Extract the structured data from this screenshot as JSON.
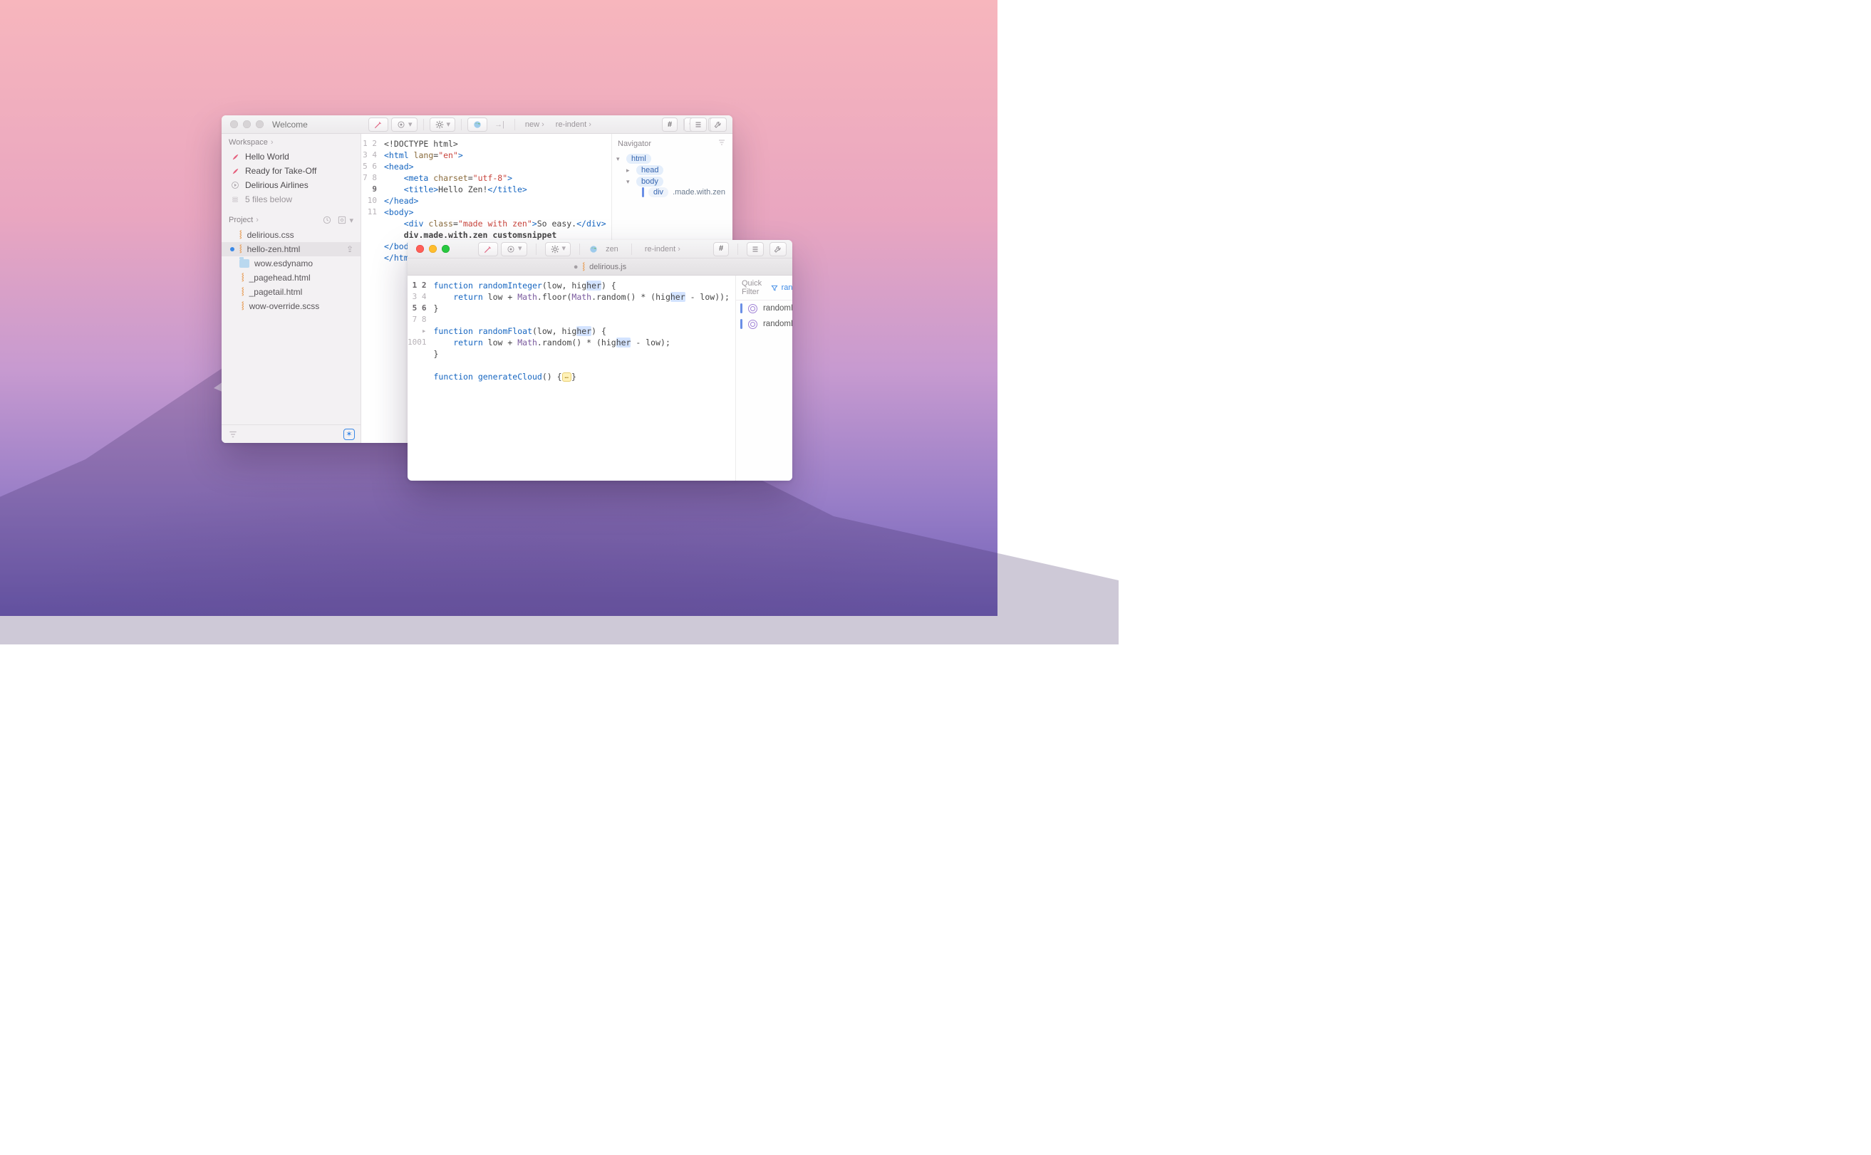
{
  "back": {
    "title": "Welcome",
    "workspace_header": "Workspace",
    "workspace_items": [
      {
        "label": "Hello World",
        "icon": "rocket"
      },
      {
        "label": "Ready for Take-Off",
        "icon": "rocket"
      },
      {
        "label": "Delirious Airlines",
        "icon": "play"
      }
    ],
    "below_label": "5 files below",
    "project_header": "Project",
    "files": [
      {
        "name": "delirious.css",
        "kind": "file",
        "selected": false
      },
      {
        "name": "hello-zen.html",
        "kind": "file",
        "selected": true
      },
      {
        "name": "wow.esdynamo",
        "kind": "folder",
        "selected": false
      },
      {
        "name": "_pagehead.html",
        "kind": "file",
        "selected": false,
        "indent": true
      },
      {
        "name": "_pagetail.html",
        "kind": "file",
        "selected": false,
        "indent": true
      },
      {
        "name": "wow-override.scss",
        "kind": "file",
        "selected": false,
        "indent": true
      }
    ],
    "toolbar": {
      "new": "new",
      "reindent": "re-indent"
    },
    "code_lines": [
      "1",
      "2",
      "3",
      "4",
      "5",
      "6",
      "7",
      "8",
      "9",
      "10",
      "11"
    ],
    "nav_title": "Navigator",
    "nav": {
      "html": "html",
      "head": "head",
      "body": "body",
      "div": "div",
      "path": ".made.with.zen"
    }
  },
  "front": {
    "toolbar": {
      "zen": "zen",
      "reindent": "re-indent"
    },
    "tab_title": "delirious.js",
    "code_lines": [
      "1",
      "2",
      "3",
      "4",
      "5",
      "6",
      "7",
      "8",
      "1001"
    ],
    "nav": {
      "quick_label": "Quick Filter",
      "filter_value": "random",
      "symbols": [
        "randomInteger",
        "randomFloat"
      ]
    }
  },
  "code_html": {
    "l1": "<!DOCTYPE html>",
    "l4_title_text": "Hello Zen!",
    "l8_text": "So easy.",
    "l9": "div.made.with.zen customsnippet"
  },
  "code_js": {
    "fn1": "randomInteger",
    "fn2": "randomFloat",
    "fn3": "generateCloud"
  }
}
